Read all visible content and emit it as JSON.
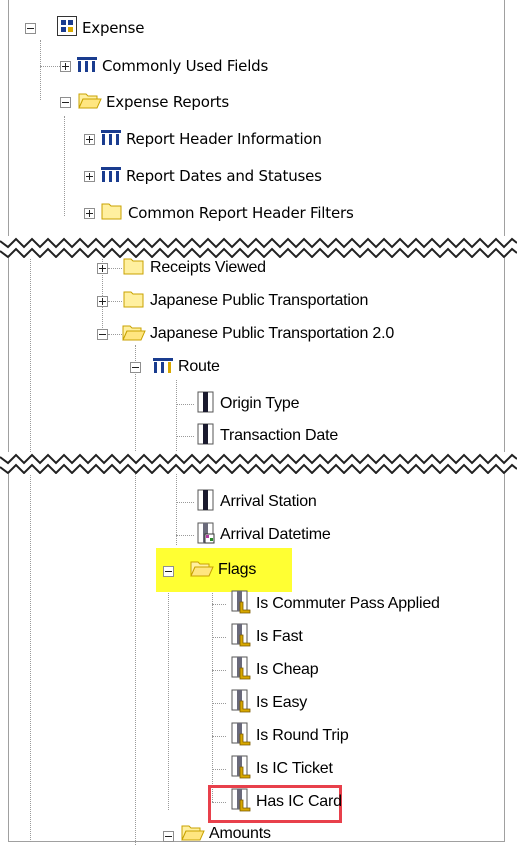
{
  "tree": {
    "root": {
      "label": "Expense"
    },
    "commonly_used_fields": {
      "label": "Commonly Used Fields"
    },
    "expense_reports": {
      "label": "Expense Reports"
    },
    "report_header_information": {
      "label": "Report Header Information"
    },
    "report_dates_and_statuses": {
      "label": "Report Dates and Statuses"
    },
    "common_report_header_filters": {
      "label": "Common Report Header Filters"
    },
    "receipts_viewed": {
      "label": "Receipts Viewed"
    },
    "japanese_public_transportation": {
      "label": "Japanese Public Transportation"
    },
    "japanese_public_transportation_2": {
      "label": "Japanese Public Transportation 2.0"
    },
    "route": {
      "label": "Route"
    },
    "origin_type": {
      "label": "Origin Type"
    },
    "transaction_date": {
      "label": "Transaction Date"
    },
    "arrival_station": {
      "label": "Arrival Station"
    },
    "arrival_datetime": {
      "label": "Arrival Datetime"
    },
    "flags": {
      "label": "Flags"
    },
    "is_commuter_pass_applied": {
      "label": "Is Commuter Pass Applied"
    },
    "is_fast": {
      "label": "Is Fast"
    },
    "is_cheap": {
      "label": "Is Cheap"
    },
    "is_easy": {
      "label": "Is Easy"
    },
    "is_round_trip": {
      "label": "Is Round Trip"
    },
    "is_ic_ticket": {
      "label": "Is IC Ticket"
    },
    "has_ic_card": {
      "label": "Has IC Card"
    },
    "amounts": {
      "label": "Amounts"
    }
  },
  "colors": {
    "highlight": "#ffff33",
    "callout_border": "#e8404b",
    "folder_fill": "#fff0a0",
    "folder_stroke": "#c8a200",
    "table_icon": "#1a3c8f"
  }
}
